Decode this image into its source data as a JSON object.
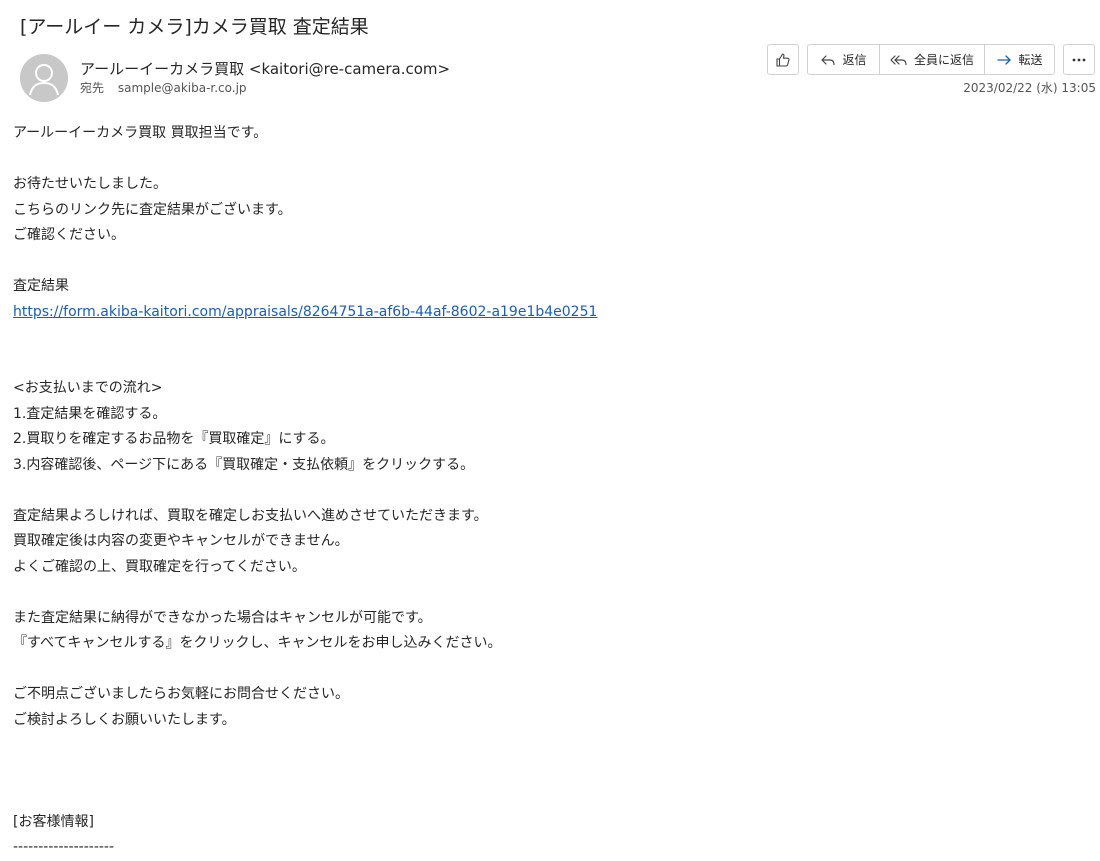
{
  "email": {
    "subject": "[アールイー カメラ]カメラ買取 査定結果",
    "sender": "アールーイーカメラ買取 <kaitori@re-camera.com>",
    "to_label": "宛先",
    "to_address": "sample@akiba-r.co.jp",
    "date": "2023/02/22 (水) 13:05"
  },
  "toolbar": {
    "like_icon": "thumbs-up-icon",
    "reply_label": "返信",
    "reply_all_label": "全員に返信",
    "forward_label": "転送",
    "more_icon": "ellipsis-icon"
  },
  "body": {
    "lines": [
      "アールーイーカメラ買取 買取担当です。",
      "",
      "お待たせいたしました。",
      "こちらのリンク先に査定結果がございます。",
      "ご確認ください。",
      "",
      "査定結果",
      "https://form.akiba-kaitori.com/appraisals/8264751a-af6b-44af-8602-a19e1b4e0251",
      "",
      "",
      "<お支払いまでの流れ>",
      "1.査定結果を確認する。",
      "2.買取りを確定するお品物を『買取確定』にする。",
      "3.内容確認後、ページ下にある『買取確定・支払依頼』をクリックする。",
      "",
      "査定結果よろしければ、買取を確定しお支払いへ進めさせていただきます。",
      "買取確定後は内容の変更やキャンセルができません。",
      "よくご確認の上、買取確定を行ってください。",
      "",
      "また査定結果に納得ができなかった場合はキャンセルが可能です。",
      "『すべてキャンセルする』をクリックし、キャンセルをお申し込みください。",
      "",
      "ご不明点ございましたらお気軽にお問合せください。",
      "ご検討よろしくお願いいたします。",
      "",
      "",
      "",
      "[お客様情報]",
      "--------------------"
    ]
  }
}
